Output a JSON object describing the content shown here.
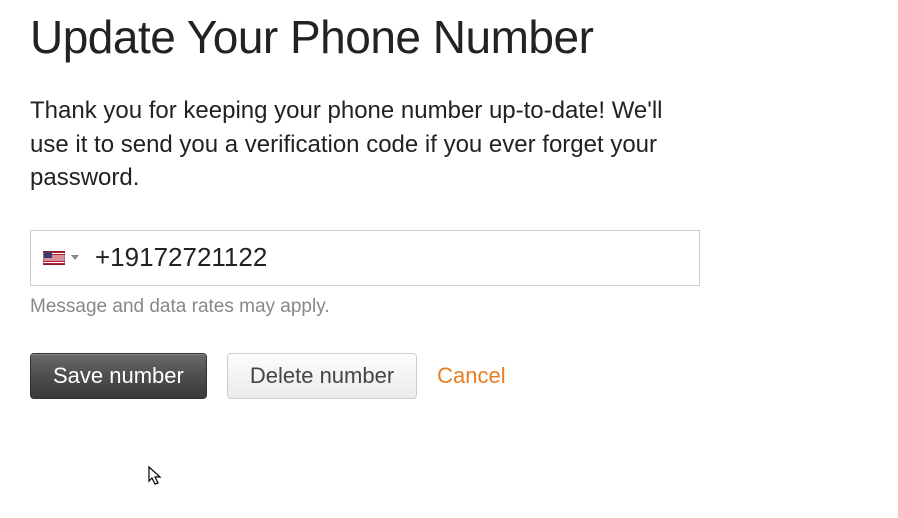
{
  "title": "Update Your Phone Number",
  "description": "Thank you for keeping your phone number up-to-date! We'll use it to send you a verification code if you ever forget your password.",
  "phone": {
    "country": "us",
    "value": "+19172721122"
  },
  "hint": "Message and data rates may apply.",
  "buttons": {
    "save": "Save number",
    "delete": "Delete number",
    "cancel": "Cancel"
  }
}
